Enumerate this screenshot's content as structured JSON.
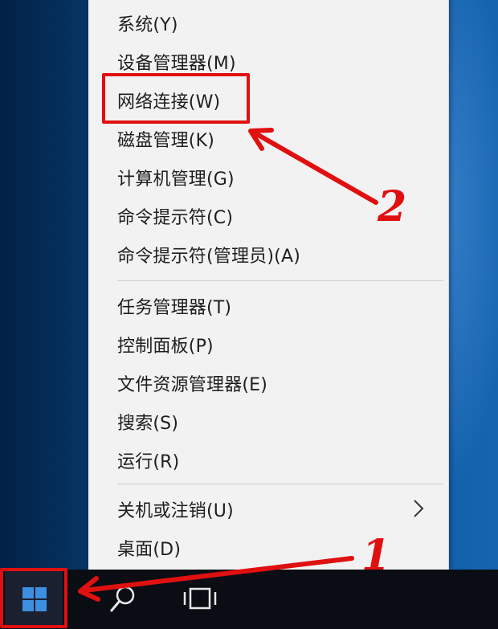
{
  "menu": {
    "items": [
      {
        "label": "系统(Y)"
      },
      {
        "label": "设备管理器(M)"
      },
      {
        "label": "网络连接(W)"
      },
      {
        "label": "磁盘管理(K)"
      },
      {
        "label": "计算机管理(G)"
      },
      {
        "label": "命令提示符(C)"
      },
      {
        "label": "命令提示符(管理员)(A)"
      },
      {
        "label": "任务管理器(T)"
      },
      {
        "label": "控制面板(P)"
      },
      {
        "label": "文件资源管理器(E)"
      },
      {
        "label": "搜索(S)"
      },
      {
        "label": "运行(R)"
      },
      {
        "label": "关机或注销(U)",
        "submenu_icon": "chevron-right-icon"
      },
      {
        "label": "桌面(D)"
      }
    ]
  },
  "taskbar": {
    "icons": [
      "windows-logo-icon",
      "search-icon",
      "task-view-icon"
    ]
  },
  "annotations": {
    "step1": "1",
    "step2": "2",
    "color": "#e01010"
  }
}
